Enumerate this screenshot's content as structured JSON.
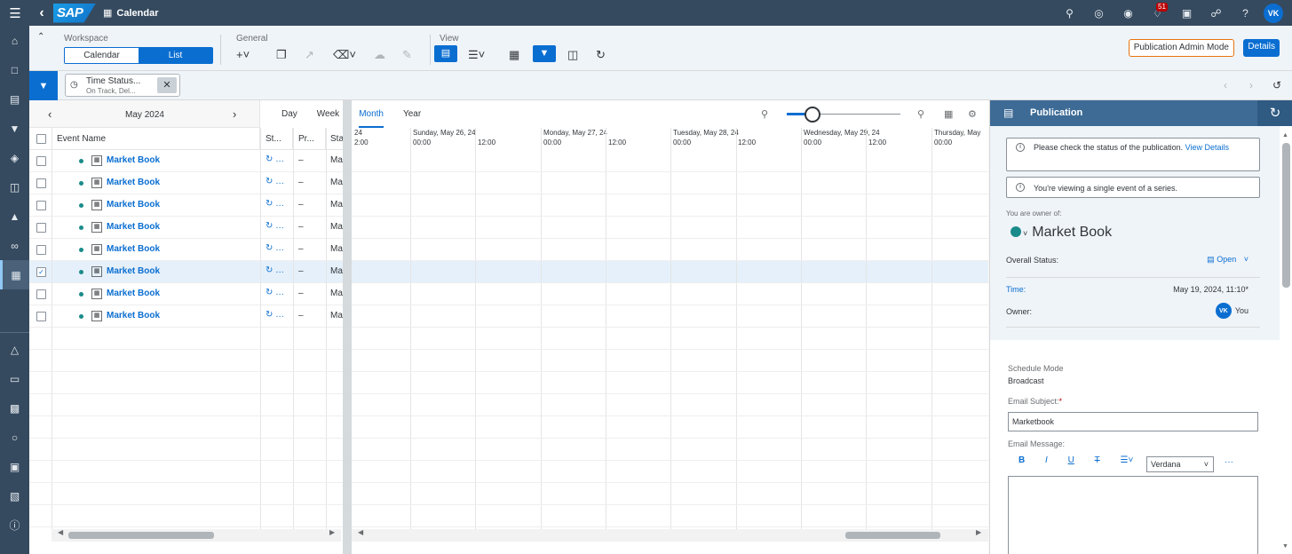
{
  "shell": {
    "menu_icon": "hamburger-icon",
    "back_icon": "back-icon",
    "logo_text": "SAP",
    "app_title": "Calendar",
    "notification_count": "51",
    "avatar_initials": "VK"
  },
  "sidenav": {
    "icons": [
      "home-icon",
      "folder-icon",
      "presentation-icon",
      "megaphone-icon",
      "globe-icon",
      "files-icon",
      "cube-icon",
      "binoculars-icon",
      "calendar-icon",
      "connections-icon",
      "monitor-icon",
      "catalog-icon",
      "lock-icon",
      "package-icon",
      "board-icon",
      "info-icon"
    ]
  },
  "toolbar": {
    "workspace_label": "Workspace",
    "calendar_label": "Calendar",
    "list_label": "List",
    "general_label": "General",
    "view_label": "View",
    "pub_admin_label": "Publication Admin Mode",
    "details_label": "Details"
  },
  "filter": {
    "chip_title": "Time Status...",
    "chip_sub": "On Track, Del..."
  },
  "calendar": {
    "month_label": "May 2024",
    "tabs": [
      "Day",
      "Week",
      "Month",
      "Year"
    ],
    "active_tab": "Month",
    "columns": {
      "event_name": "Event Name",
      "status": "St...",
      "priority": "Pr...",
      "start": "Sta"
    },
    "rows": [
      {
        "name": "Market Book",
        "status": "↻ …",
        "priority": "–",
        "start": "Ma"
      },
      {
        "name": "Market Book",
        "status": "↻ …",
        "priority": "–",
        "start": "Ma"
      },
      {
        "name": "Market Book",
        "status": "↻ …",
        "priority": "–",
        "start": "Ma"
      },
      {
        "name": "Market Book",
        "status": "↻ …",
        "priority": "–",
        "start": "Ma"
      },
      {
        "name": "Market Book",
        "status": "↻ …",
        "priority": "–",
        "start": "Ma"
      },
      {
        "name": "Market Book",
        "status": "↻ …",
        "priority": "–",
        "start": "Ma",
        "selected": true
      },
      {
        "name": "Market Book",
        "status": "↻ …",
        "priority": "–",
        "start": "Ma"
      },
      {
        "name": "Market Book",
        "status": "↻ …",
        "priority": "–",
        "start": "Ma"
      }
    ],
    "day_headers": [
      {
        "title": "24",
        "times": [
          "2:00"
        ]
      },
      {
        "title": "Sunday, May 26, 24",
        "times": [
          "00:00",
          "12:00"
        ]
      },
      {
        "title": "Monday, May 27, 24",
        "times": [
          "00:00",
          "12:00"
        ]
      },
      {
        "title": "Tuesday, May 28, 24",
        "times": [
          "00:00",
          "12:00"
        ]
      },
      {
        "title": "Wednesday, May 29, 24",
        "times": [
          "00:00",
          "12:00"
        ]
      },
      {
        "title": "Thursday, May",
        "times": [
          "00:00"
        ]
      }
    ]
  },
  "panel": {
    "title": "Publication",
    "msg1_text": "Please check the status of the publication.",
    "msg1_link": "View Details",
    "msg2_text": "You're viewing a single event of a series.",
    "owner_note": "You are owner of:",
    "event_title": "Market Book",
    "overall_status_label": "Overall Status:",
    "overall_status_value": "Open",
    "time_label": "Time:",
    "time_value": "May 19, 2024, 11:10*",
    "owner_label": "Owner:",
    "owner_initials": "VK",
    "owner_value": "You",
    "schedule_mode_label": "Schedule Mode",
    "schedule_mode_value": "Broadcast",
    "email_subject_label": "Email Subject:",
    "email_subject_required": "*",
    "email_subject_value": "Marketbook",
    "email_message_label": "Email Message:",
    "font_value": "Verdana",
    "rte_bold": "B",
    "rte_italic": "I",
    "rte_underline": "U",
    "rte_strike": "T",
    "rte_more": "···"
  }
}
